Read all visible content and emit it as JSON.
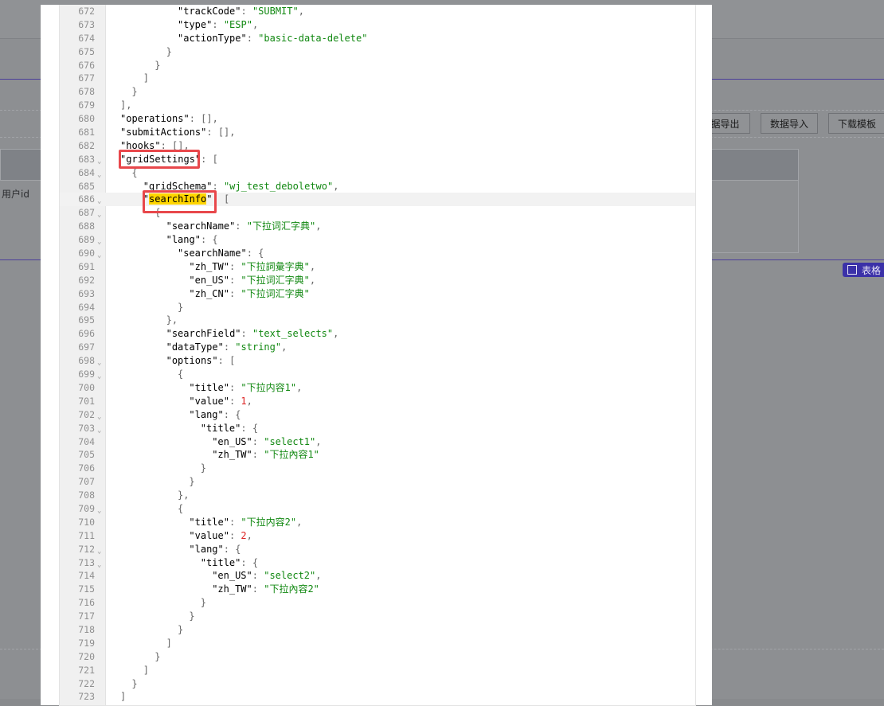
{
  "background": {
    "buttons": [
      "据导出",
      "数据导入",
      "下载模板"
    ],
    "column_label": "用户id",
    "table_toggle_label": "表格"
  },
  "editor": {
    "lines": [
      {
        "n": "672",
        "fold": false,
        "indent": 10,
        "tokens": [
          {
            "t": "\"trackCode\"",
            "c": "k"
          },
          {
            "t": ": ",
            "c": "p"
          },
          {
            "t": "\"SUBMIT\"",
            "c": "s"
          },
          {
            "t": ",",
            "c": "p"
          }
        ]
      },
      {
        "n": "673",
        "fold": false,
        "indent": 10,
        "tokens": [
          {
            "t": "\"type\"",
            "c": "k"
          },
          {
            "t": ": ",
            "c": "p"
          },
          {
            "t": "\"ESP\"",
            "c": "s"
          },
          {
            "t": ",",
            "c": "p"
          }
        ]
      },
      {
        "n": "674",
        "fold": false,
        "indent": 10,
        "tokens": [
          {
            "t": "\"actionType\"",
            "c": "k"
          },
          {
            "t": ": ",
            "c": "p"
          },
          {
            "t": "\"basic-data-delete\"",
            "c": "s"
          }
        ]
      },
      {
        "n": "675",
        "fold": false,
        "indent": 8,
        "tokens": [
          {
            "t": "}",
            "c": "p"
          }
        ]
      },
      {
        "n": "676",
        "fold": false,
        "indent": 6,
        "tokens": [
          {
            "t": "}",
            "c": "p"
          }
        ]
      },
      {
        "n": "677",
        "fold": false,
        "indent": 4,
        "tokens": [
          {
            "t": "]",
            "c": "p"
          }
        ]
      },
      {
        "n": "678",
        "fold": false,
        "indent": 2,
        "tokens": [
          {
            "t": "}",
            "c": "p"
          }
        ]
      },
      {
        "n": "679",
        "fold": false,
        "indent": 0,
        "tokens": [
          {
            "t": "],",
            "c": "p"
          }
        ]
      },
      {
        "n": "680",
        "fold": false,
        "indent": 0,
        "tokens": [
          {
            "t": "\"operations\"",
            "c": "k"
          },
          {
            "t": ": [],",
            "c": "p"
          }
        ]
      },
      {
        "n": "681",
        "fold": false,
        "indent": 0,
        "tokens": [
          {
            "t": "\"submitActions\"",
            "c": "k"
          },
          {
            "t": ": [],",
            "c": "p"
          }
        ]
      },
      {
        "n": "682",
        "fold": false,
        "indent": 0,
        "tokens": [
          {
            "t": "\"hooks\"",
            "c": "k"
          },
          {
            "t": ": [],",
            "c": "p"
          }
        ]
      },
      {
        "n": "683",
        "fold": true,
        "indent": 0,
        "tokens": [
          {
            "t": "\"gridSettings\"",
            "c": "k"
          },
          {
            "t": ": [",
            "c": "p"
          }
        ]
      },
      {
        "n": "684",
        "fold": true,
        "indent": 2,
        "tokens": [
          {
            "t": "{",
            "c": "p"
          }
        ]
      },
      {
        "n": "685",
        "fold": false,
        "indent": 4,
        "tokens": [
          {
            "t": "\"gridSchema\"",
            "c": "k"
          },
          {
            "t": ": ",
            "c": "p"
          },
          {
            "t": "\"wj_test_deboletwo\"",
            "c": "s"
          },
          {
            "t": ",",
            "c": "p"
          }
        ]
      },
      {
        "n": "686",
        "fold": true,
        "indent": 4,
        "active": true,
        "tokens": [
          {
            "t": "\"",
            "c": "k"
          },
          {
            "t": "searchInfo",
            "c": "k",
            "hl": true
          },
          {
            "t": "\"",
            "c": "k"
          },
          {
            "t": ": [",
            "c": "p"
          }
        ]
      },
      {
        "n": "687",
        "fold": true,
        "indent": 6,
        "tokens": [
          {
            "t": "{",
            "c": "p"
          }
        ]
      },
      {
        "n": "688",
        "fold": false,
        "indent": 8,
        "tokens": [
          {
            "t": "\"searchName\"",
            "c": "k"
          },
          {
            "t": ": ",
            "c": "p"
          },
          {
            "t": "\"下拉词汇字典\"",
            "c": "s"
          },
          {
            "t": ",",
            "c": "p"
          }
        ]
      },
      {
        "n": "689",
        "fold": true,
        "indent": 8,
        "tokens": [
          {
            "t": "\"lang\"",
            "c": "k"
          },
          {
            "t": ": {",
            "c": "p"
          }
        ]
      },
      {
        "n": "690",
        "fold": true,
        "indent": 10,
        "tokens": [
          {
            "t": "\"searchName\"",
            "c": "k"
          },
          {
            "t": ": {",
            "c": "p"
          }
        ]
      },
      {
        "n": "691",
        "fold": false,
        "indent": 12,
        "tokens": [
          {
            "t": "\"zh_TW\"",
            "c": "k"
          },
          {
            "t": ": ",
            "c": "p"
          },
          {
            "t": "\"下拉詞彙字典\"",
            "c": "s"
          },
          {
            "t": ",",
            "c": "p"
          }
        ]
      },
      {
        "n": "692",
        "fold": false,
        "indent": 12,
        "tokens": [
          {
            "t": "\"en_US\"",
            "c": "k"
          },
          {
            "t": ": ",
            "c": "p"
          },
          {
            "t": "\"下拉词汇字典\"",
            "c": "s"
          },
          {
            "t": ",",
            "c": "p"
          }
        ]
      },
      {
        "n": "693",
        "fold": false,
        "indent": 12,
        "tokens": [
          {
            "t": "\"zh_CN\"",
            "c": "k"
          },
          {
            "t": ": ",
            "c": "p"
          },
          {
            "t": "\"下拉词汇字典\"",
            "c": "s"
          }
        ]
      },
      {
        "n": "694",
        "fold": false,
        "indent": 10,
        "tokens": [
          {
            "t": "}",
            "c": "p"
          }
        ]
      },
      {
        "n": "695",
        "fold": false,
        "indent": 8,
        "tokens": [
          {
            "t": "},",
            "c": "p"
          }
        ]
      },
      {
        "n": "696",
        "fold": false,
        "indent": 8,
        "tokens": [
          {
            "t": "\"searchField\"",
            "c": "k"
          },
          {
            "t": ": ",
            "c": "p"
          },
          {
            "t": "\"text_selects\"",
            "c": "s"
          },
          {
            "t": ",",
            "c": "p"
          }
        ]
      },
      {
        "n": "697",
        "fold": false,
        "indent": 8,
        "tokens": [
          {
            "t": "\"dataType\"",
            "c": "k"
          },
          {
            "t": ": ",
            "c": "p"
          },
          {
            "t": "\"string\"",
            "c": "s"
          },
          {
            "t": ",",
            "c": "p"
          }
        ]
      },
      {
        "n": "698",
        "fold": true,
        "indent": 8,
        "tokens": [
          {
            "t": "\"options\"",
            "c": "k"
          },
          {
            "t": ": [",
            "c": "p"
          }
        ]
      },
      {
        "n": "699",
        "fold": true,
        "indent": 10,
        "tokens": [
          {
            "t": "{",
            "c": "p"
          }
        ]
      },
      {
        "n": "700",
        "fold": false,
        "indent": 12,
        "tokens": [
          {
            "t": "\"title\"",
            "c": "k"
          },
          {
            "t": ": ",
            "c": "p"
          },
          {
            "t": "\"下拉内容1\"",
            "c": "s"
          },
          {
            "t": ",",
            "c": "p"
          }
        ]
      },
      {
        "n": "701",
        "fold": false,
        "indent": 12,
        "tokens": [
          {
            "t": "\"value\"",
            "c": "k"
          },
          {
            "t": ": ",
            "c": "p"
          },
          {
            "t": "1",
            "c": "n"
          },
          {
            "t": ",",
            "c": "p"
          }
        ]
      },
      {
        "n": "702",
        "fold": true,
        "indent": 12,
        "tokens": [
          {
            "t": "\"lang\"",
            "c": "k"
          },
          {
            "t": ": {",
            "c": "p"
          }
        ]
      },
      {
        "n": "703",
        "fold": true,
        "indent": 14,
        "tokens": [
          {
            "t": "\"title\"",
            "c": "k"
          },
          {
            "t": ": {",
            "c": "p"
          }
        ]
      },
      {
        "n": "704",
        "fold": false,
        "indent": 16,
        "tokens": [
          {
            "t": "\"en_US\"",
            "c": "k"
          },
          {
            "t": ": ",
            "c": "p"
          },
          {
            "t": "\"select1\"",
            "c": "s"
          },
          {
            "t": ",",
            "c": "p"
          }
        ]
      },
      {
        "n": "705",
        "fold": false,
        "indent": 16,
        "tokens": [
          {
            "t": "\"zh_TW\"",
            "c": "k"
          },
          {
            "t": ": ",
            "c": "p"
          },
          {
            "t": "\"下拉內容1\"",
            "c": "s"
          }
        ]
      },
      {
        "n": "706",
        "fold": false,
        "indent": 14,
        "tokens": [
          {
            "t": "}",
            "c": "p"
          }
        ]
      },
      {
        "n": "707",
        "fold": false,
        "indent": 12,
        "tokens": [
          {
            "t": "}",
            "c": "p"
          }
        ]
      },
      {
        "n": "708",
        "fold": false,
        "indent": 10,
        "tokens": [
          {
            "t": "},",
            "c": "p"
          }
        ]
      },
      {
        "n": "709",
        "fold": true,
        "indent": 10,
        "tokens": [
          {
            "t": "{",
            "c": "p"
          }
        ]
      },
      {
        "n": "710",
        "fold": false,
        "indent": 12,
        "tokens": [
          {
            "t": "\"title\"",
            "c": "k"
          },
          {
            "t": ": ",
            "c": "p"
          },
          {
            "t": "\"下拉内容2\"",
            "c": "s"
          },
          {
            "t": ",",
            "c": "p"
          }
        ]
      },
      {
        "n": "711",
        "fold": false,
        "indent": 12,
        "tokens": [
          {
            "t": "\"value\"",
            "c": "k"
          },
          {
            "t": ": ",
            "c": "p"
          },
          {
            "t": "2",
            "c": "n"
          },
          {
            "t": ",",
            "c": "p"
          }
        ]
      },
      {
        "n": "712",
        "fold": true,
        "indent": 12,
        "tokens": [
          {
            "t": "\"lang\"",
            "c": "k"
          },
          {
            "t": ": {",
            "c": "p"
          }
        ]
      },
      {
        "n": "713",
        "fold": true,
        "indent": 14,
        "tokens": [
          {
            "t": "\"title\"",
            "c": "k"
          },
          {
            "t": ": {",
            "c": "p"
          }
        ]
      },
      {
        "n": "714",
        "fold": false,
        "indent": 16,
        "tokens": [
          {
            "t": "\"en_US\"",
            "c": "k"
          },
          {
            "t": ": ",
            "c": "p"
          },
          {
            "t": "\"select2\"",
            "c": "s"
          },
          {
            "t": ",",
            "c": "p"
          }
        ]
      },
      {
        "n": "715",
        "fold": false,
        "indent": 16,
        "tokens": [
          {
            "t": "\"zh_TW\"",
            "c": "k"
          },
          {
            "t": ": ",
            "c": "p"
          },
          {
            "t": "\"下拉內容2\"",
            "c": "s"
          }
        ]
      },
      {
        "n": "716",
        "fold": false,
        "indent": 14,
        "tokens": [
          {
            "t": "}",
            "c": "p"
          }
        ]
      },
      {
        "n": "717",
        "fold": false,
        "indent": 12,
        "tokens": [
          {
            "t": "}",
            "c": "p"
          }
        ]
      },
      {
        "n": "718",
        "fold": false,
        "indent": 10,
        "tokens": [
          {
            "t": "}",
            "c": "p"
          }
        ]
      },
      {
        "n": "719",
        "fold": false,
        "indent": 8,
        "tokens": [
          {
            "t": "]",
            "c": "p"
          }
        ]
      },
      {
        "n": "720",
        "fold": false,
        "indent": 6,
        "tokens": [
          {
            "t": "}",
            "c": "p"
          }
        ]
      },
      {
        "n": "721",
        "fold": false,
        "indent": 4,
        "tokens": [
          {
            "t": "]",
            "c": "p"
          }
        ]
      },
      {
        "n": "722",
        "fold": false,
        "indent": 2,
        "tokens": [
          {
            "t": "}",
            "c": "p"
          }
        ]
      },
      {
        "n": "723",
        "fold": false,
        "indent": 0,
        "tokens": [
          {
            "t": "]",
            "c": "p"
          }
        ]
      }
    ]
  }
}
